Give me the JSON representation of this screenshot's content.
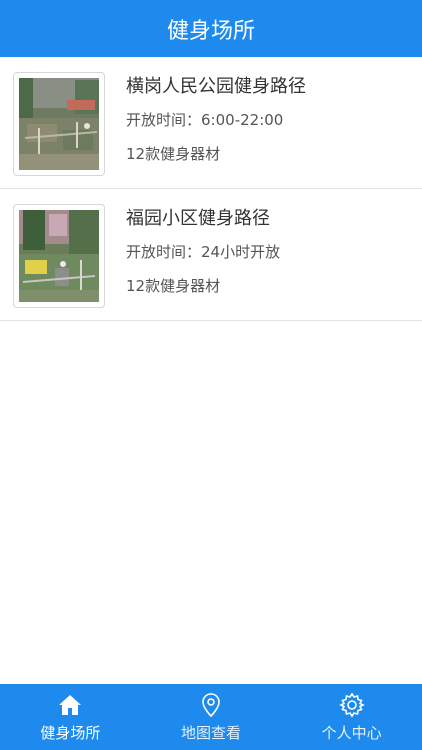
{
  "header": {
    "title": "健身场所"
  },
  "venues": [
    {
      "name": "横岗人民公园健身路径",
      "hours_label": "开放时间：",
      "hours_value": "6:00-22:00",
      "equipment": "12款健身器材"
    },
    {
      "name": "福园小区健身路径",
      "hours_label": "开放时间：",
      "hours_value": "24小时开放",
      "equipment": "12款健身器材"
    }
  ],
  "tabbar": {
    "tabs": [
      {
        "label": "健身场所",
        "icon": "home-icon",
        "active": true
      },
      {
        "label": "地图查看",
        "icon": "map-pin-icon",
        "active": false
      },
      {
        "label": "个人中心",
        "icon": "gear-icon",
        "active": false
      }
    ]
  },
  "colors": {
    "brand": "#1e8aed"
  }
}
